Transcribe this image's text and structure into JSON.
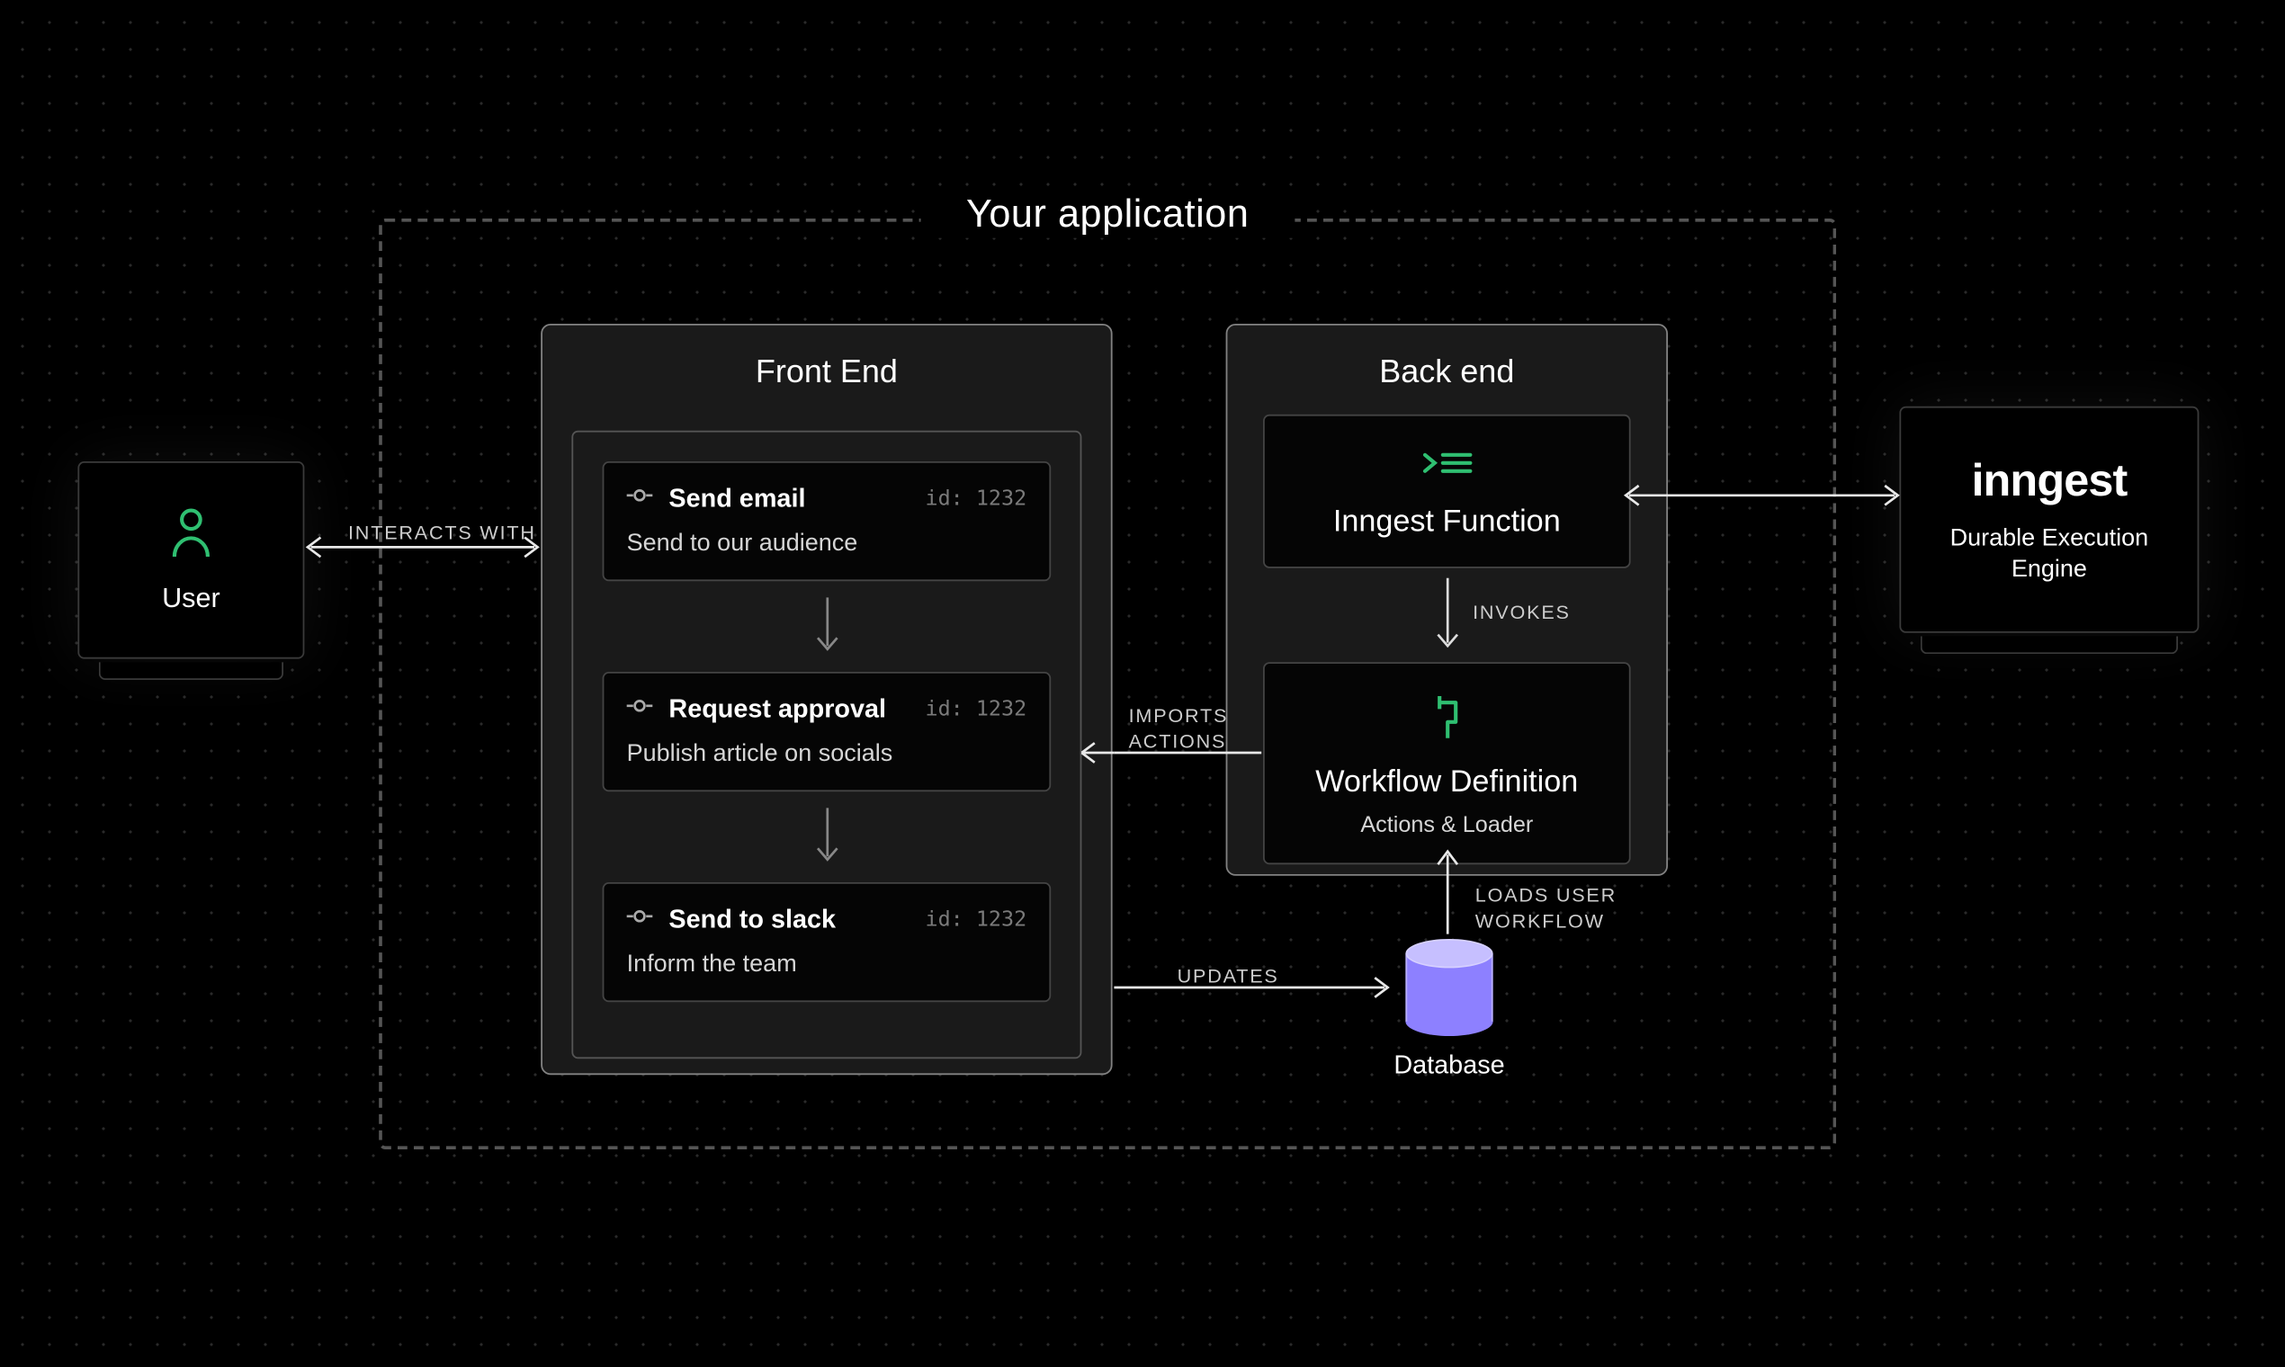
{
  "app_container_label": "Your application",
  "user": {
    "label": "User"
  },
  "frontend": {
    "title": "Front End",
    "steps": [
      {
        "title": "Send email",
        "id": "id: 1232",
        "sub": "Send to our audience"
      },
      {
        "title": "Request approval",
        "id": "id: 1232",
        "sub": "Publish article on socials"
      },
      {
        "title": "Send to slack",
        "id": "id: 1232",
        "sub": "Inform the team"
      }
    ]
  },
  "backend": {
    "title": "Back end",
    "function_card": {
      "title": "Inngest Function"
    },
    "invokes_label": "INVOKES",
    "definition_card": {
      "title": "Workflow Definition",
      "sub": "Actions & Loader"
    }
  },
  "inngest": {
    "logo_text": "inngest",
    "sub": "Durable Execution Engine"
  },
  "database": {
    "label": "Database"
  },
  "connectors": {
    "interacts": "INTERACTS WITH",
    "imports": "IMPORTS ACTIONS",
    "updates": "UPDATES",
    "loads": "LOADS USER WORKFLOW"
  }
}
